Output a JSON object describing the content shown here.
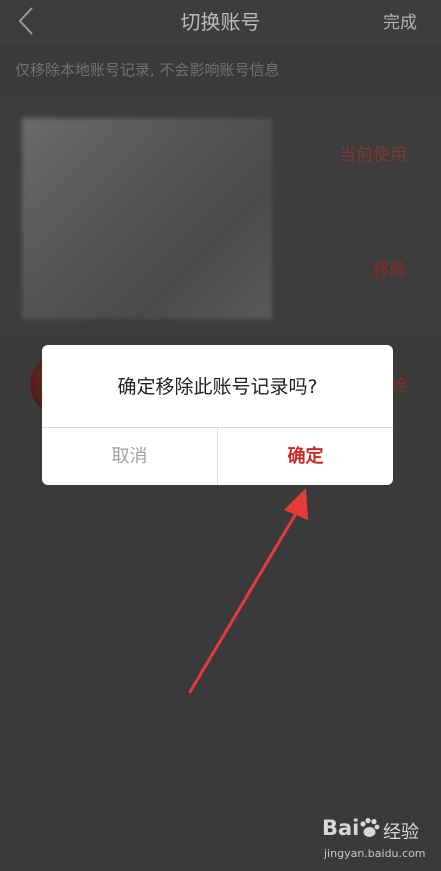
{
  "nav": {
    "title": "切换账号",
    "done": "完成",
    "back_icon": "chevron-left-icon"
  },
  "hint": "仅移除本地账号记录, 不会影响账号信息",
  "accounts": [
    {
      "status": "当前使用",
      "action": "移除"
    },
    {
      "action": "除"
    }
  ],
  "dialog": {
    "message": "确定移除此账号记录吗?",
    "cancel": "取消",
    "confirm": "确定"
  },
  "watermark": {
    "brand": "Bai",
    "brand_cn": "经验",
    "url": "jingyan.baidu.com"
  },
  "colors": {
    "accent": "#c92b26",
    "overlay": "#3a3a3a",
    "arrow": "#e63b3b"
  }
}
